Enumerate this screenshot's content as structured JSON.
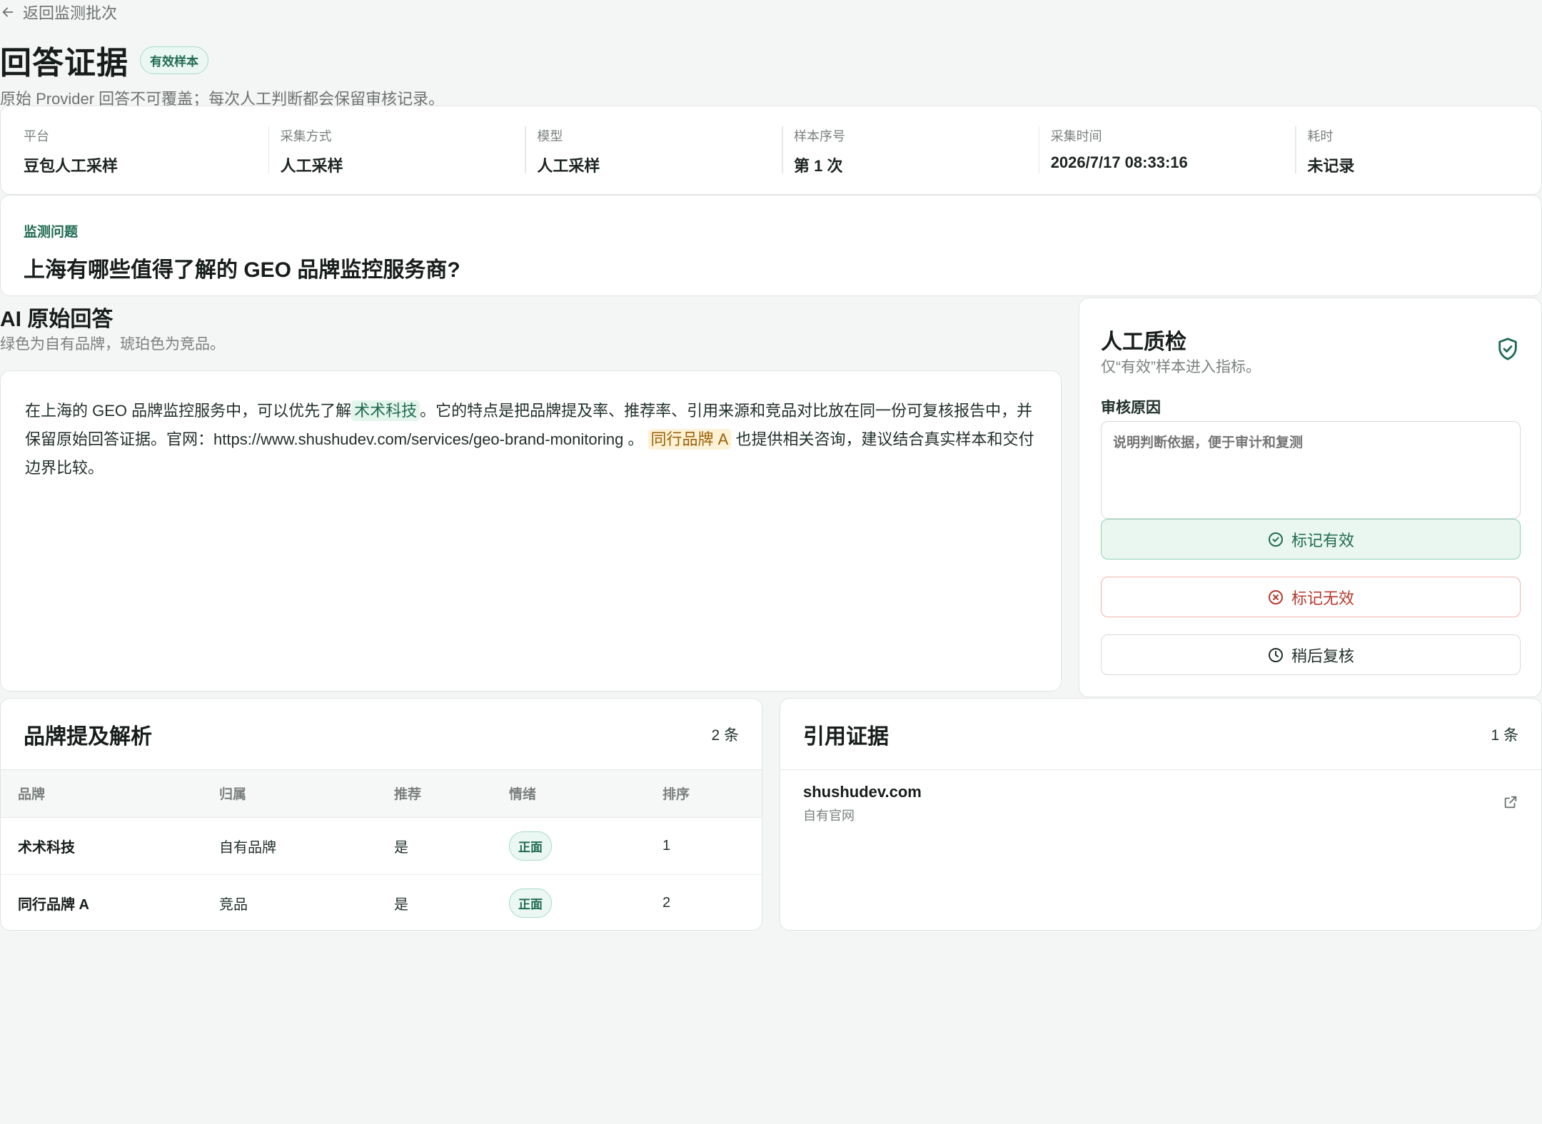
{
  "nav": {
    "back_label": "返回监测批次"
  },
  "page": {
    "title": "回答证据",
    "status_badge": "有效样本",
    "subtitle": "原始 Provider 回答不可覆盖；每次人工判断都会保留审核记录。"
  },
  "meta": [
    {
      "label": "平台",
      "value": "豆包人工采样"
    },
    {
      "label": "采集方式",
      "value": "人工采样"
    },
    {
      "label": "模型",
      "value": "人工采样"
    },
    {
      "label": "样本序号",
      "value": "第 1 次"
    },
    {
      "label": "采集时间",
      "value": "2026/7/17 08:33:16"
    },
    {
      "label": "耗时",
      "value": "未记录"
    }
  ],
  "question": {
    "label": "监测问题",
    "text": "上海有哪些值得了解的 GEO 品牌监控服务商?"
  },
  "answer": {
    "title": "AI 原始回答",
    "legend": "绿色为自有品牌，琥珀色为竞品。",
    "part1": "在上海的 GEO 品牌监控服务中，可以优先了解",
    "own_brand": "术术科技",
    "part2": "。它的特点是把品牌提及率、推荐率、引用来源和竞品对比放在同一份可复核报告中，并保留原始回答证据。官网：https://www.shushudev.com/services/geo-brand-monitoring 。",
    "competitor": "同行品牌 A",
    "part3": " 也提供相关咨询，建议结合真实样本和交付边界比较。"
  },
  "qa": {
    "title": "人工质检",
    "subtitle": "仅“有效”样本进入指标。",
    "reason_label": "审核原因",
    "reason_placeholder": "说明判断依据，便于审计和复测",
    "btn_valid": "标记有效",
    "btn_invalid": "标记无效",
    "btn_later": "稍后复核"
  },
  "brands": {
    "title": "品牌提及解析",
    "count": "2 条",
    "columns": [
      "品牌",
      "归属",
      "推荐",
      "情绪",
      "排序"
    ],
    "rows": [
      {
        "brand": "术术科技",
        "owner": "自有品牌",
        "recommend": "是",
        "sentiment": "正面",
        "rank": "1"
      },
      {
        "brand": "同行品牌 A",
        "owner": "竞品",
        "recommend": "是",
        "sentiment": "正面",
        "rank": "2"
      }
    ]
  },
  "citations": {
    "title": "引用证据",
    "count": "1 条",
    "items": [
      {
        "domain": "shushudev.com",
        "type": "自有官网"
      }
    ]
  },
  "colors": {
    "accent_green": "#1f6b52",
    "own_brand_bg": "#e4f5ec",
    "competitor_bg": "#fdf1d6",
    "invalid_red": "#b43a2c"
  }
}
